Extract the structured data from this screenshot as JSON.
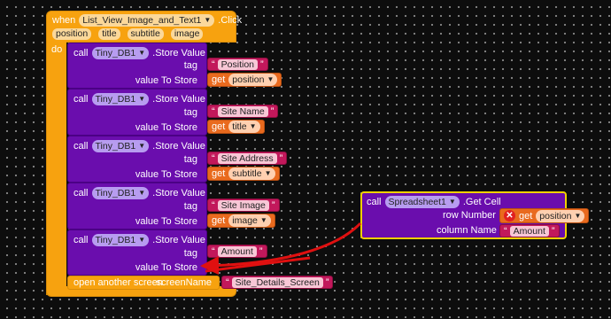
{
  "event": {
    "when_label": "when",
    "component": "List_View_Image_and_Text1",
    "event_name": ".Click",
    "params": [
      "position",
      "title",
      "subtitle",
      "image"
    ],
    "do_label": "do"
  },
  "store_blocks": [
    {
      "call_label": "call",
      "component": "Tiny_DB1",
      "method": ".Store Value",
      "tag_label": "tag",
      "tag_value": "Position",
      "value_label": "value To Store",
      "get_label": "get",
      "get_var": "position"
    },
    {
      "call_label": "call",
      "component": "Tiny_DB1",
      "method": ".Store Value",
      "tag_label": "tag",
      "tag_value": "Site Name",
      "value_label": "value To Store",
      "get_label": "get",
      "get_var": "title"
    },
    {
      "call_label": "call",
      "component": "Tiny_DB1",
      "method": ".Store Value",
      "tag_label": "tag",
      "tag_value": "Site Address",
      "value_label": "value To Store",
      "get_label": "get",
      "get_var": "subtitle"
    },
    {
      "call_label": "call",
      "component": "Tiny_DB1",
      "method": ".Store Value",
      "tag_label": "tag",
      "tag_value": "Site Image",
      "value_label": "value To Store",
      "get_label": "get",
      "get_var": "image"
    },
    {
      "call_label": "call",
      "component": "Tiny_DB1",
      "method": ".Store Value",
      "tag_label": "tag",
      "tag_value": "Amount",
      "value_label": "value To Store"
    }
  ],
  "open_screen": {
    "label": "open another screen",
    "param_label": "screenName",
    "value": "Site_Details_Screen"
  },
  "sheet_block": {
    "call_label": "call",
    "component": "Spreadsheet1",
    "method": ".Get Cell",
    "row_label": "row Number",
    "col_label": "column Name",
    "get_label": "get",
    "get_var": "position",
    "col_value": "Amount",
    "error_symbol": "✕"
  },
  "colors": {
    "event": "#f7a20f",
    "component_call": "#6a0dad",
    "text_block": "#c2185b",
    "variable_get": "#e96a1e",
    "annotation_arrow": "#e01010",
    "selection_outline": "#f0d000"
  },
  "icons": [
    "chevron-down-icon",
    "error-icon",
    "quote-icon"
  ]
}
